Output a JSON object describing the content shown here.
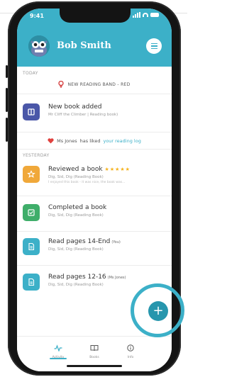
{
  "status_bar": {
    "time": "9:41"
  },
  "header": {
    "user_name": "Bob Smith"
  },
  "sections": {
    "today": "TODAY",
    "yesterday": "YESTERDAY"
  },
  "band_notice": "NEW READING BAND - RED",
  "activity": {
    "new_book": {
      "title": "New book added",
      "subtitle": "Mr Cliff the Climber | Reading book)"
    },
    "liked": {
      "who": "Ms Jones",
      "mid": "has liked",
      "link": "your reading log"
    },
    "reviewed": {
      "title": "Reviewed a book",
      "stars": "★★★★★",
      "subtitle": "Dig, Sid, Dig (Reading Book)",
      "note": "I enjoyed this book - it was nice, the book was..."
    },
    "completed": {
      "title": "Completed a book",
      "subtitle": "Dig, Sid, Dig (Reading Book)"
    },
    "read1": {
      "title": "Read pages 14-End",
      "tag": "(You)",
      "subtitle": "Dig, Sid, Dig (Reading Book)"
    },
    "read2": {
      "title": "Read pages 12-16",
      "tag": "(Ms Jones)",
      "subtitle": "Dig, Sid, Dig (Reading Book)"
    }
  },
  "tabs": {
    "activity": "Activity",
    "books": "Books",
    "info": "Info"
  },
  "fab_symbol": "+",
  "colors": {
    "brand_teal": "#3cb0c8",
    "new_book_icon": "#4a57a8",
    "review_icon": "#f0a83a",
    "completed_icon": "#3fae6a",
    "read_icon": "#3cb0c8",
    "heart": "#e0413e",
    "band_pin": "#d64545"
  },
  "icons": {
    "status_icons": [
      "signal-icon",
      "wifi-icon",
      "battery-icon"
    ],
    "band": "location-pin-icon",
    "liked": "heart-icon",
    "new_book": "book-icon",
    "reviewed": "star-icon",
    "completed": "checkmark-icon",
    "read": "document-icon",
    "tabs": [
      "activity-icon",
      "open-book-icon",
      "info-icon"
    ]
  }
}
